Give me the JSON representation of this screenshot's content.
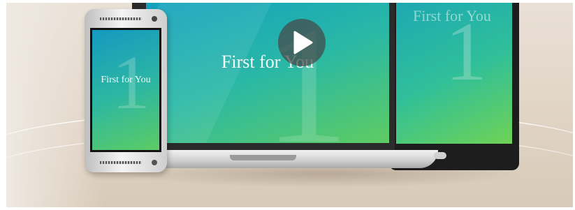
{
  "video": {
    "title": "First for You",
    "play_button_icon": "play-icon",
    "accent": "#2bb6a4"
  },
  "screens": {
    "phone_text": "First for You",
    "laptop_text": "First for You",
    "tablet_text": "First for You",
    "logo_numeral": "1"
  }
}
